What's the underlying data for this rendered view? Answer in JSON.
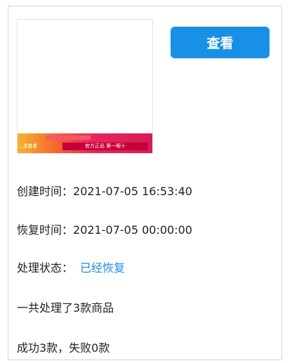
{
  "thumbnail": {
    "banner_price": ".388",
    "banner_slogan": "官方正品 第一眼十"
  },
  "actions": {
    "view_label": "查看"
  },
  "details": {
    "created_label": "创建时间：",
    "created_value": "2021-07-05 16:53:40",
    "restored_label": "恢复时间：",
    "restored_value": "2021-07-05 00:00:00",
    "status_label": "处理状态：",
    "status_value": "已经恢复",
    "total_text": "一共处理了3款商品",
    "result_text": "成功3款，失败0款"
  },
  "colors": {
    "button_bg": "#1890e6",
    "status_text": "#1d8ce6",
    "border": "#d6d6d6"
  }
}
